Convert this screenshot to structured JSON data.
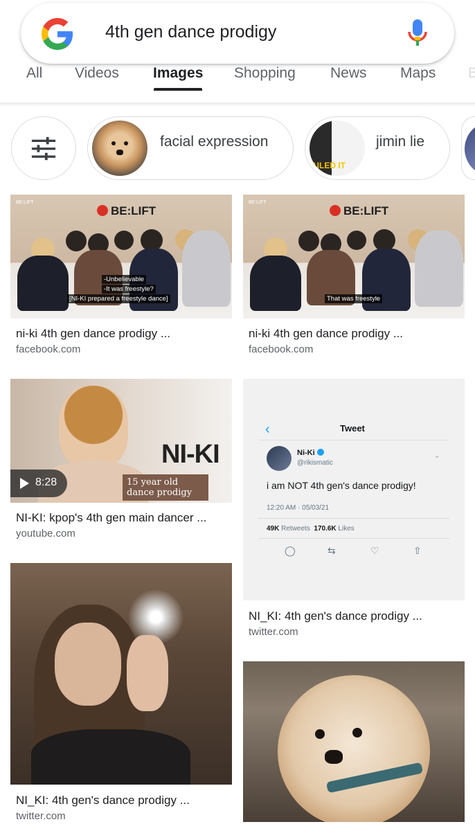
{
  "search": {
    "query": "4th gen dance prodigy"
  },
  "tabs": [
    {
      "label": "All"
    },
    {
      "label": "Videos"
    },
    {
      "label": "Images",
      "active": true
    },
    {
      "label": "Shopping"
    },
    {
      "label": "News"
    },
    {
      "label": "Maps"
    },
    {
      "label": "B"
    }
  ],
  "chips": [
    {
      "label": "facial expression"
    },
    {
      "label": "jimin lie",
      "thumb_text": "AILED IT"
    }
  ],
  "results": [
    {
      "title": "ni-ki 4th gen dance prodigy ...",
      "source": "facebook.com",
      "thumb": {
        "brand": "BE:LIFT",
        "tag": "BE:LIFT",
        "subtitles": [
          "-Unbelievable",
          "-It was freestyle?",
          "[NI-KI prepared a freestyle dance]"
        ]
      }
    },
    {
      "title": "ni-ki 4th gen dance prodigy ...",
      "source": "facebook.com",
      "thumb": {
        "brand": "BE:LIFT",
        "tag": "BE:LIFT",
        "subtitles": [
          "That was freestyle"
        ]
      }
    },
    {
      "title": "NI-KI: kpop's 4th gen main dancer ...",
      "source": "youtube.com",
      "thumb": {
        "heading": "NI-KI",
        "caption_line1": "15 year old",
        "caption_line2": "dance prodigy",
        "duration": "8:28"
      }
    },
    {
      "title": "NI_KI: 4th gen's dance prodigy ...",
      "source": "twitter.com",
      "thumb": {
        "header": "Tweet",
        "name": "Ni-Ki",
        "handle": "@rikismatic",
        "text": "i am NOT 4th gen's dance prodigy!",
        "time": "12:20 AM · 05/03/21",
        "retweets": "49K",
        "retweets_label": "Retweets",
        "likes": "170.6K",
        "likes_label": "Likes"
      }
    },
    {
      "title": "NI_KI: 4th gen's dance prodigy ...",
      "source": "twitter.com"
    },
    {
      "title": "",
      "source": ""
    }
  ],
  "colors": {
    "google_blue": "#4285F4",
    "google_red": "#EA4335",
    "google_yellow": "#FBBC05",
    "google_green": "#34A853",
    "tab_active": "#202124",
    "tab_inactive": "#5f6368"
  }
}
